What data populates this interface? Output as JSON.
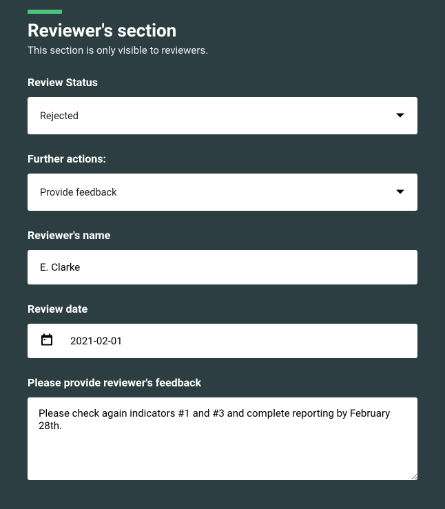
{
  "section": {
    "title": "Reviewer's section",
    "subtitle": "This section is only visible to reviewers."
  },
  "fields": {
    "review_status": {
      "label": "Review Status",
      "value": "Rejected"
    },
    "further_actions": {
      "label": "Further actions:",
      "value": "Provide feedback"
    },
    "reviewer_name": {
      "label": "Reviewer's name",
      "value": "E. Clarke"
    },
    "review_date": {
      "label": "Review date",
      "value": "2021-02-01"
    },
    "feedback": {
      "label": "Please provide reviewer's feedback",
      "value": "Please check again indicators #1 and #3 and complete reporting by February 28th."
    }
  },
  "colors": {
    "accent": "#4ac47a",
    "background": "#2d3e43"
  }
}
